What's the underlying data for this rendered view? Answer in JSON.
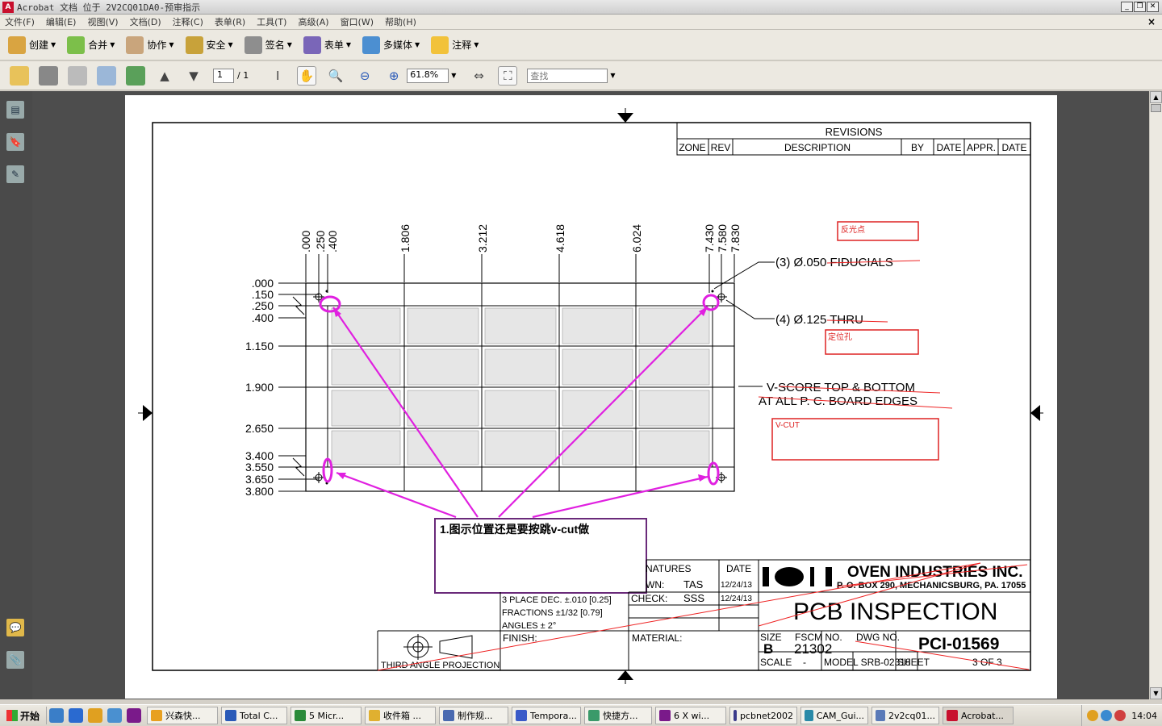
{
  "window": {
    "title": "Acrobat 文档 位于 2V2CQ01DA0-预审指示"
  },
  "menu": [
    "文件(F)",
    "编辑(E)",
    "视图(V)",
    "文档(D)",
    "注释(C)",
    "表单(R)",
    "工具(T)",
    "高级(A)",
    "窗口(W)",
    "帮助(H)"
  ],
  "toolbar1": [
    "创建",
    "合并",
    "协作",
    "安全",
    "签名",
    "表单",
    "多媒体",
    "注释"
  ],
  "toolbar2": {
    "page_current": "1",
    "page_total": "/ 1",
    "zoom": "61.8%",
    "find_placeholder": "查找"
  },
  "drawing": {
    "revisions_title": "REVISIONS",
    "rev_headers": [
      "ZONE",
      "REV",
      "DESCRIPTION",
      "BY",
      "DATE",
      "APPR.",
      "DATE"
    ],
    "x_dims": [
      ".000",
      ".250",
      ".400",
      "1.806",
      "3.212",
      "4.618",
      "6.024",
      "7.430",
      "7.580",
      "7.830"
    ],
    "y_dims": [
      ".000",
      ".150",
      ".250",
      ".400",
      "1.150",
      "1.900",
      "2.650",
      "3.400",
      "3.550",
      "3.650",
      "3.800"
    ],
    "note_fiducials": "(3) Ø.050 FIDUCIALS",
    "note_thru": "(4) Ø.125 THRU",
    "note_vscore1": "V-SCORE TOP & BOTTOM",
    "note_vscore2": "AT ALL P. C. BOARD EDGES",
    "box_fiducial": "反光点",
    "box_holes": "定位孔",
    "box_vcut": "V-CUT",
    "callout": "1.图示位置还是要按跳v-cut做",
    "company": "OVEN INDUSTRIES INC.",
    "address": "P. O. BOX 290, MECHANICSBURG, PA. 17055",
    "signatures": "NATURES",
    "date_h": "DATE",
    "drawn": "WN:",
    "drawn_by": "TAS",
    "drawn_date": "12/24/13",
    "check": "CHECK:",
    "check_by": "SSS",
    "check_date": "12/24/13",
    "tol1": "3 PLACE DEC. ±.010 [0.25]",
    "tol2": "FRACTIONS ±1/32 [0.79]",
    "tol3": "ANGLES ± 2°",
    "projection": "THIRD ANGLE PROJECTION",
    "finish": "FINISH:",
    "material": "MATERIAL:",
    "doc_title": "PCB INSPECTION",
    "size_h": "SIZE",
    "size": "B",
    "fscm_h": "FSCM NO.",
    "fscm": "21302",
    "dwg_h": "DWG NO.",
    "dwg": "PCI-01569",
    "scale": "SCALE",
    "scale_val": "-",
    "model": "MODEL SRB-02318",
    "sheet": "SHEET",
    "sheet_val": "3 OF 3"
  },
  "taskbar": {
    "start": "开始",
    "tasks": [
      "兴森快...",
      "Total C...",
      "5 Micr...",
      "收件箱 ...",
      "制作规...",
      "Tempora...",
      "快捷方...",
      "6 X wi...",
      "pcbnet2002",
      "CAM_Gui...",
      "2v2cq01...",
      "Acrobat..."
    ],
    "clock": "14:04"
  }
}
